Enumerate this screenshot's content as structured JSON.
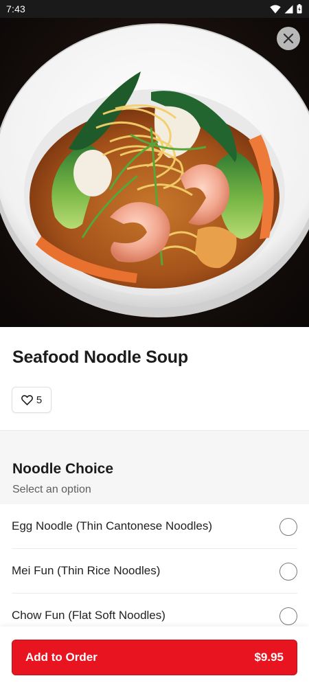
{
  "status_bar": {
    "time": "7:43",
    "icons": [
      "wifi-icon",
      "cell-signal-icon",
      "battery-charging-icon"
    ]
  },
  "hero": {
    "image_subject": "bowl of seafood noodle soup",
    "close_icon": "close-icon"
  },
  "item": {
    "title": "Seafood Noodle Soup",
    "like_icon": "heart-icon",
    "like_count": "5"
  },
  "option_group": {
    "title": "Noodle Choice",
    "subtitle": "Select an option",
    "options": [
      {
        "label": "Egg Noodle (Thin Cantonese Noodles)",
        "selected": false
      },
      {
        "label": "Mei Fun (Thin Rice Noodles)",
        "selected": false
      },
      {
        "label": "Chow Fun (Flat Soft Noodles)",
        "selected": false
      }
    ]
  },
  "footer": {
    "add_label": "Add to Order",
    "price": "$9.95"
  },
  "colors": {
    "accent": "#e8141f",
    "status_bar": "#1a1a1a",
    "section_band": "#f6f6f7"
  }
}
